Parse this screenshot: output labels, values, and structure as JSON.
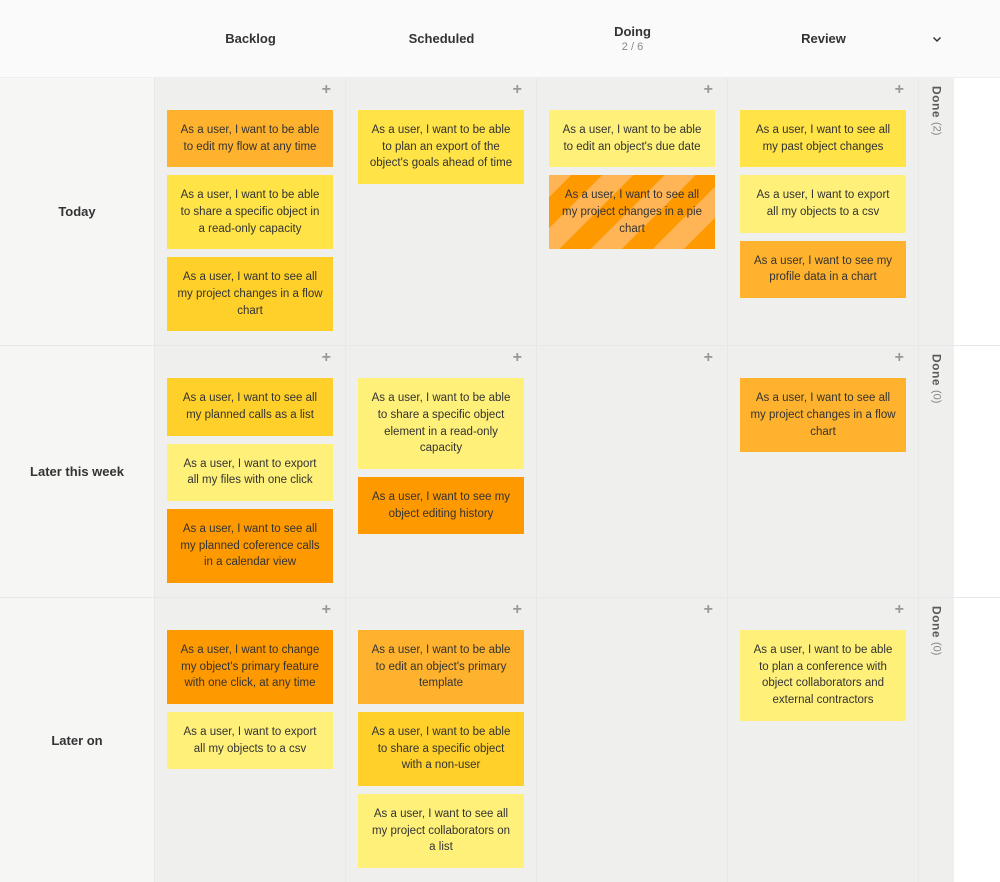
{
  "columns": [
    {
      "title": "Backlog",
      "sub": ""
    },
    {
      "title": "Scheduled",
      "sub": ""
    },
    {
      "title": "Doing",
      "sub": "2 / 6"
    },
    {
      "title": "Review",
      "sub": ""
    }
  ],
  "add_glyph": "+",
  "done_label": "Done",
  "rows": [
    {
      "label": "Today",
      "done_count": "(2)",
      "cells": {
        "backlog": [
          {
            "text": "As a user, I want to be able to edit my flow at any time",
            "cls": "c-o1"
          },
          {
            "text": "As a user, I want to be able to share a specific object in a read-only capacity",
            "cls": "c-y2"
          },
          {
            "text": "As a user, I want to see all my project changes in a flow chart",
            "cls": "c-y1"
          }
        ],
        "scheduled": [
          {
            "text": "As a user, I want to be able to plan an export of the object's goals ahead of time",
            "cls": "c-y2"
          }
        ],
        "doing": [
          {
            "text": "As a user, I want to be able to edit an object's due date",
            "cls": "c-y3"
          },
          {
            "text": "As a user, I want to see all my project changes in a pie chart",
            "cls": "striped"
          }
        ],
        "review": [
          {
            "text": "As a user, I want to see all my past object changes",
            "cls": "c-y2"
          },
          {
            "text": "As a user, I want to export all my objects to a csv",
            "cls": "c-y3"
          },
          {
            "text": "As a user, I want to see my profile data in a chart",
            "cls": "c-o1"
          }
        ]
      }
    },
    {
      "label": "Later this week",
      "done_count": "(0)",
      "cells": {
        "backlog": [
          {
            "text": "As a user, I want to see all my planned calls as a list",
            "cls": "c-y1"
          },
          {
            "text": "As a user, I want to export all my files with one click",
            "cls": "c-y3"
          },
          {
            "text": "As a user, I want to see all my planned coference calls in a calendar view",
            "cls": "c-o2"
          }
        ],
        "scheduled": [
          {
            "text": "As a user, I want to be able to share a specific object element in a read-only capacity",
            "cls": "c-y3"
          },
          {
            "text": "As a user, I want to see my object editing history",
            "cls": "c-o2"
          }
        ],
        "doing": [],
        "review": [
          {
            "text": "As a user, I want to see all my project changes in a flow chart",
            "cls": "c-o1"
          }
        ]
      }
    },
    {
      "label": "Later on",
      "done_count": "(0)",
      "cells": {
        "backlog": [
          {
            "text": "As a user, I want to change my object's primary feature with one click, at any time",
            "cls": "c-o2"
          },
          {
            "text": "As a user, I want to export all my objects to a csv",
            "cls": "c-y3"
          }
        ],
        "scheduled": [
          {
            "text": "As a user, I want to be able to edit an object's primary template",
            "cls": "c-o1"
          },
          {
            "text": "As a user, I want to be able to share a specific object with a non-user",
            "cls": "c-y1"
          },
          {
            "text": "As a user, I want to see all my project collaborators on a list",
            "cls": "c-y3"
          }
        ],
        "doing": [],
        "review": [
          {
            "text": "As a user, I want to be able to plan a conference with object collaborators and external contractors",
            "cls": "c-y3"
          }
        ]
      }
    }
  ]
}
